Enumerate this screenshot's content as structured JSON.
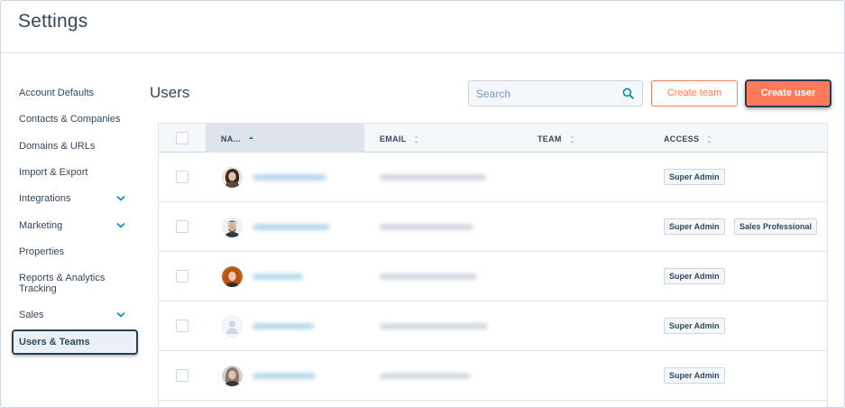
{
  "header": {
    "title": "Settings"
  },
  "sidebar": {
    "items": [
      {
        "label": "Account Defaults"
      },
      {
        "label": "Contacts & Companies"
      },
      {
        "label": "Domains & URLs"
      },
      {
        "label": "Import & Export"
      },
      {
        "label": "Integrations",
        "expandable": true
      },
      {
        "label": "Marketing",
        "expandable": true
      },
      {
        "label": "Properties"
      },
      {
        "label": "Reports & Analytics Tracking"
      },
      {
        "label": "Sales",
        "expandable": true
      },
      {
        "label": "Users & Teams",
        "active": true
      }
    ]
  },
  "main": {
    "title": "Users",
    "search": {
      "placeholder": "Search",
      "value": ""
    },
    "create_team_label": "Create team",
    "create_user_label": "Create user"
  },
  "table": {
    "columns": [
      {
        "label": "NA...",
        "sorted": "ascending"
      },
      {
        "label": "EMAIL"
      },
      {
        "label": "TEAM"
      },
      {
        "label": "ACCESS"
      }
    ],
    "rows": [
      {
        "avatar": "photo-woman-dark-hair",
        "access": [
          "Super Admin"
        ]
      },
      {
        "avatar": "photo-man-beard",
        "access": [
          "Super Admin",
          "Sales Professional"
        ]
      },
      {
        "avatar": "photo-woman-red-hair",
        "access": [
          "Super Admin"
        ]
      },
      {
        "avatar": "placeholder-person-icon",
        "access": [
          "Super Admin"
        ]
      },
      {
        "avatar": "photo-woman-light-hair",
        "access": [
          "Super Admin"
        ]
      }
    ]
  },
  "colors": {
    "accent": "#ff7a59",
    "text": "#33475b",
    "border": "#cbd6e2",
    "header_bg": "#f5f8fa",
    "sorted_bg": "#dfe3eb",
    "focus_outline": "#2d3e50"
  }
}
